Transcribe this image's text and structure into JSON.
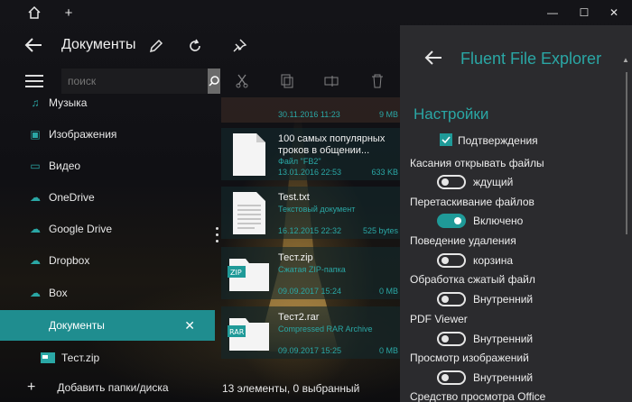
{
  "colors": {
    "accent": "#2aa7a5",
    "active_bg": "#1f8d8f",
    "panel_bg": "#2b2b2e"
  },
  "window": {
    "home_icon": "home-icon",
    "new_tab_icon": "plus-icon",
    "minimize": "—",
    "maximize": "☐",
    "close": "✕"
  },
  "header": {
    "title": "Документы",
    "icons": [
      "back-arrow-icon",
      "edit-pencil-icon",
      "refresh-icon",
      "pin-icon"
    ]
  },
  "search": {
    "placeholder": "поиск"
  },
  "sidebar": {
    "items": [
      {
        "label": "Музыка",
        "icon": "music-icon"
      },
      {
        "label": "Изображения",
        "icon": "image-icon"
      },
      {
        "label": "Видео",
        "icon": "video-icon"
      },
      {
        "label": "OneDrive",
        "icon": "cloud-icon"
      },
      {
        "label": "Google Drive",
        "icon": "cloud-icon"
      },
      {
        "label": "Dropbox",
        "icon": "cloud-icon"
      },
      {
        "label": "Box",
        "icon": "cloud-icon"
      },
      {
        "label": "Документы",
        "icon": "folder-icon",
        "active": true
      },
      {
        "label": "Тест.zip",
        "icon": "zip-icon"
      }
    ],
    "add_label": "Добавить папки/диска"
  },
  "file_toolbar": [
    "cut-icon",
    "copy-icon",
    "rename-icon",
    "delete-icon"
  ],
  "files": [
    {
      "name": "",
      "type": "",
      "date": "30.11.2016 11:23",
      "size": "9 MB",
      "kind": "image"
    },
    {
      "name": "100 самых популярных троков в общении...",
      "type": "Файл \"FB2\"",
      "date": "13.01.2016 22:53",
      "size": "633 KB",
      "kind": "doc"
    },
    {
      "name": "Test.txt",
      "type": "Текстовый документ",
      "date": "16.12.2015 22:32",
      "size": "525 bytes",
      "kind": "txt"
    },
    {
      "name": "Тест.zip",
      "type": "Сжатая ZIP-папка",
      "date": "09.09.2017 15:24",
      "size": "0 MB",
      "kind": "ZIP"
    },
    {
      "name": "Тест2.rar",
      "type": "Compressed RAR Archive",
      "date": "09.09.2017 15:25",
      "size": "0 MB",
      "kind": "RAR"
    }
  ],
  "status": {
    "text": "13 элементы, 0 выбранный"
  },
  "settings": {
    "app_title": "Fluent File Explorer",
    "section": "Настройки",
    "confirmations": {
      "label": "Подтверждения",
      "checked": true
    },
    "rows": [
      {
        "title": "Касания открывать файлы",
        "value": "ждущий",
        "on": false
      },
      {
        "title": "Перетаскивание файлов",
        "value": "Включено",
        "on": true
      },
      {
        "title": "Поведение удаления",
        "value": "корзина",
        "on": false
      },
      {
        "title": "Обработка сжатый файл",
        "value": "Внутренний",
        "on": false
      },
      {
        "title": "PDF Viewer",
        "value": "Внутренний",
        "on": false
      },
      {
        "title": "Просмотр изображений",
        "value": "Внутренний",
        "on": false
      },
      {
        "title": "Средство просмотра Office",
        "value": "",
        "on": false
      }
    ]
  }
}
